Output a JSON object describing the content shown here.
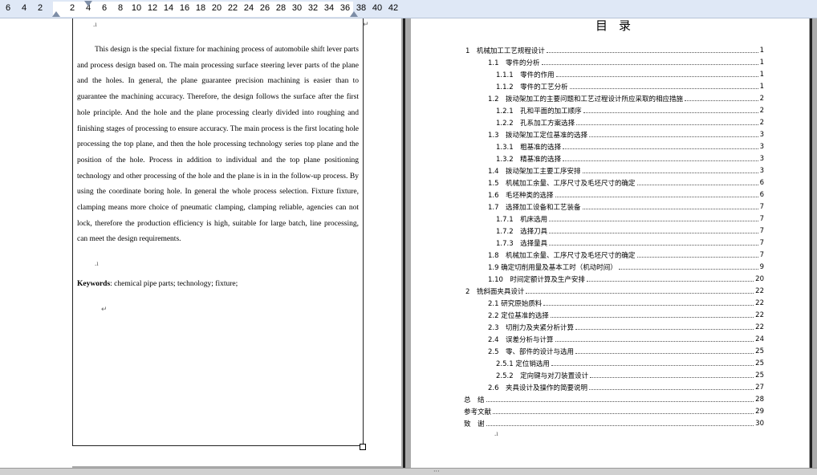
{
  "ruler": {
    "ticks": [
      "6",
      "4",
      "2",
      "2",
      "4",
      "6",
      "8",
      "10",
      "12",
      "14",
      "16",
      "18",
      "20",
      "22",
      "24",
      "26",
      "28",
      "30",
      "32",
      "34",
      "36",
      "38",
      "40",
      "42"
    ]
  },
  "left_page": {
    "abstract": "This design is the special fixture for machining process of automobile shift lever parts and process design based on. The main processing surface steering lever parts of the plane and the holes. In general, the plane guarantee precision machining is easier than to guarantee the machining accuracy. Therefore, the design follows the surface after the first hole principle. And the hole and the plane processing clearly divided into roughing and finishing stages of processing to ensure accuracy. The main process is the first locating hole processing the top plane, and then the hole processing technology series top plane and the position of the hole. Process in addition to individual and the top plane positioning technology and other processing of the hole and the plane is in in the follow-up process. By using the coordinate boring hole. In general the whole process selection. Fixture fixture, clamping means more choice of pneumatic clamping, clamping reliable, agencies can not lock, therefore the production efficiency is high, suitable for large batch, line processing, can meet the design requirements.",
    "keywords_label": "Keywords",
    "keywords_text": ": chemical pipe parts; technology; fixture;"
  },
  "right_page": {
    "title": "目录",
    "entries": [
      {
        "label": "1　机械加工工艺规程设计",
        "page": "1",
        "level": 0
      },
      {
        "label": "1.1　零件的分析",
        "page": "1",
        "level": 1
      },
      {
        "label": "1.1.1　零件的作用",
        "page": "1",
        "level": 2
      },
      {
        "label": "1.1.2　零件的工艺分析",
        "page": "1",
        "level": 2
      },
      {
        "label": "1.2　拨动架加工的主要问题和工艺过程设计所应采取的相应措施",
        "page": "2",
        "level": 1
      },
      {
        "label": "1.2.1　孔和平面的加工顺序",
        "page": "2",
        "level": 2
      },
      {
        "label": "1.2.2　孔系加工方案选择",
        "page": "2",
        "level": 2
      },
      {
        "label": "1.3　拨动架加工定位基准的选择",
        "page": "3",
        "level": 1
      },
      {
        "label": "1.3.1　粗基准的选择",
        "page": "3",
        "level": 2
      },
      {
        "label": "1.3.2　精基准的选择",
        "page": "3",
        "level": 2
      },
      {
        "label": "1.4　拨动架加工主要工序安排",
        "page": "3",
        "level": 1
      },
      {
        "label": "1.5　机械加工余量、工序尺寸及毛坯尺寸的确定",
        "page": "6",
        "level": 1
      },
      {
        "label": "1.6　毛坯种类的选择",
        "page": "6",
        "level": 1
      },
      {
        "label": "1.7　选择加工设备和工艺装备",
        "page": "7",
        "level": 1
      },
      {
        "label": "1.7.1　机床选用",
        "page": "7",
        "level": 2
      },
      {
        "label": "1.7.2　选择刀具",
        "page": "7",
        "level": 2
      },
      {
        "label": "1.7.3　选择量具",
        "page": "7",
        "level": 2
      },
      {
        "label": "1.8　机械加工余量、工序尺寸及毛坯尺寸的确定",
        "page": "7",
        "level": 1
      },
      {
        "label": "1.9 确定切削用量及基本工时（机动时间）",
        "page": "9",
        "level": 1
      },
      {
        "label": "1.10　时间定额计算及生产安排",
        "page": "20",
        "level": 1
      },
      {
        "label": "2　铣斜面夹具设计",
        "page": "22",
        "level": 0
      },
      {
        "label": "2.1 研究原始质料",
        "page": "22",
        "level": 1
      },
      {
        "label": "2.2 定位基准的选择",
        "page": "22",
        "level": 1
      },
      {
        "label": "2.3　切削力及夹紧分析计算",
        "page": "22",
        "level": 1
      },
      {
        "label": "2.4　误差分析与计算",
        "page": "24",
        "level": 1
      },
      {
        "label": "2.5　零、部件的设计与选用",
        "page": "25",
        "level": 1
      },
      {
        "label": "2.5.1 定位销选用",
        "page": "25",
        "level": 2
      },
      {
        "label": "2.5.2　定向键与对刀装置设计",
        "page": "25",
        "level": 2
      },
      {
        "label": "2.6　夹具设计及操作的简要说明",
        "page": "27",
        "level": 1
      },
      {
        "label": "总　结",
        "page": "28",
        "level": 0
      },
      {
        "label": "参考文献",
        "page": "29",
        "level": 0
      },
      {
        "label": "致　谢",
        "page": "30",
        "level": 0
      }
    ]
  }
}
